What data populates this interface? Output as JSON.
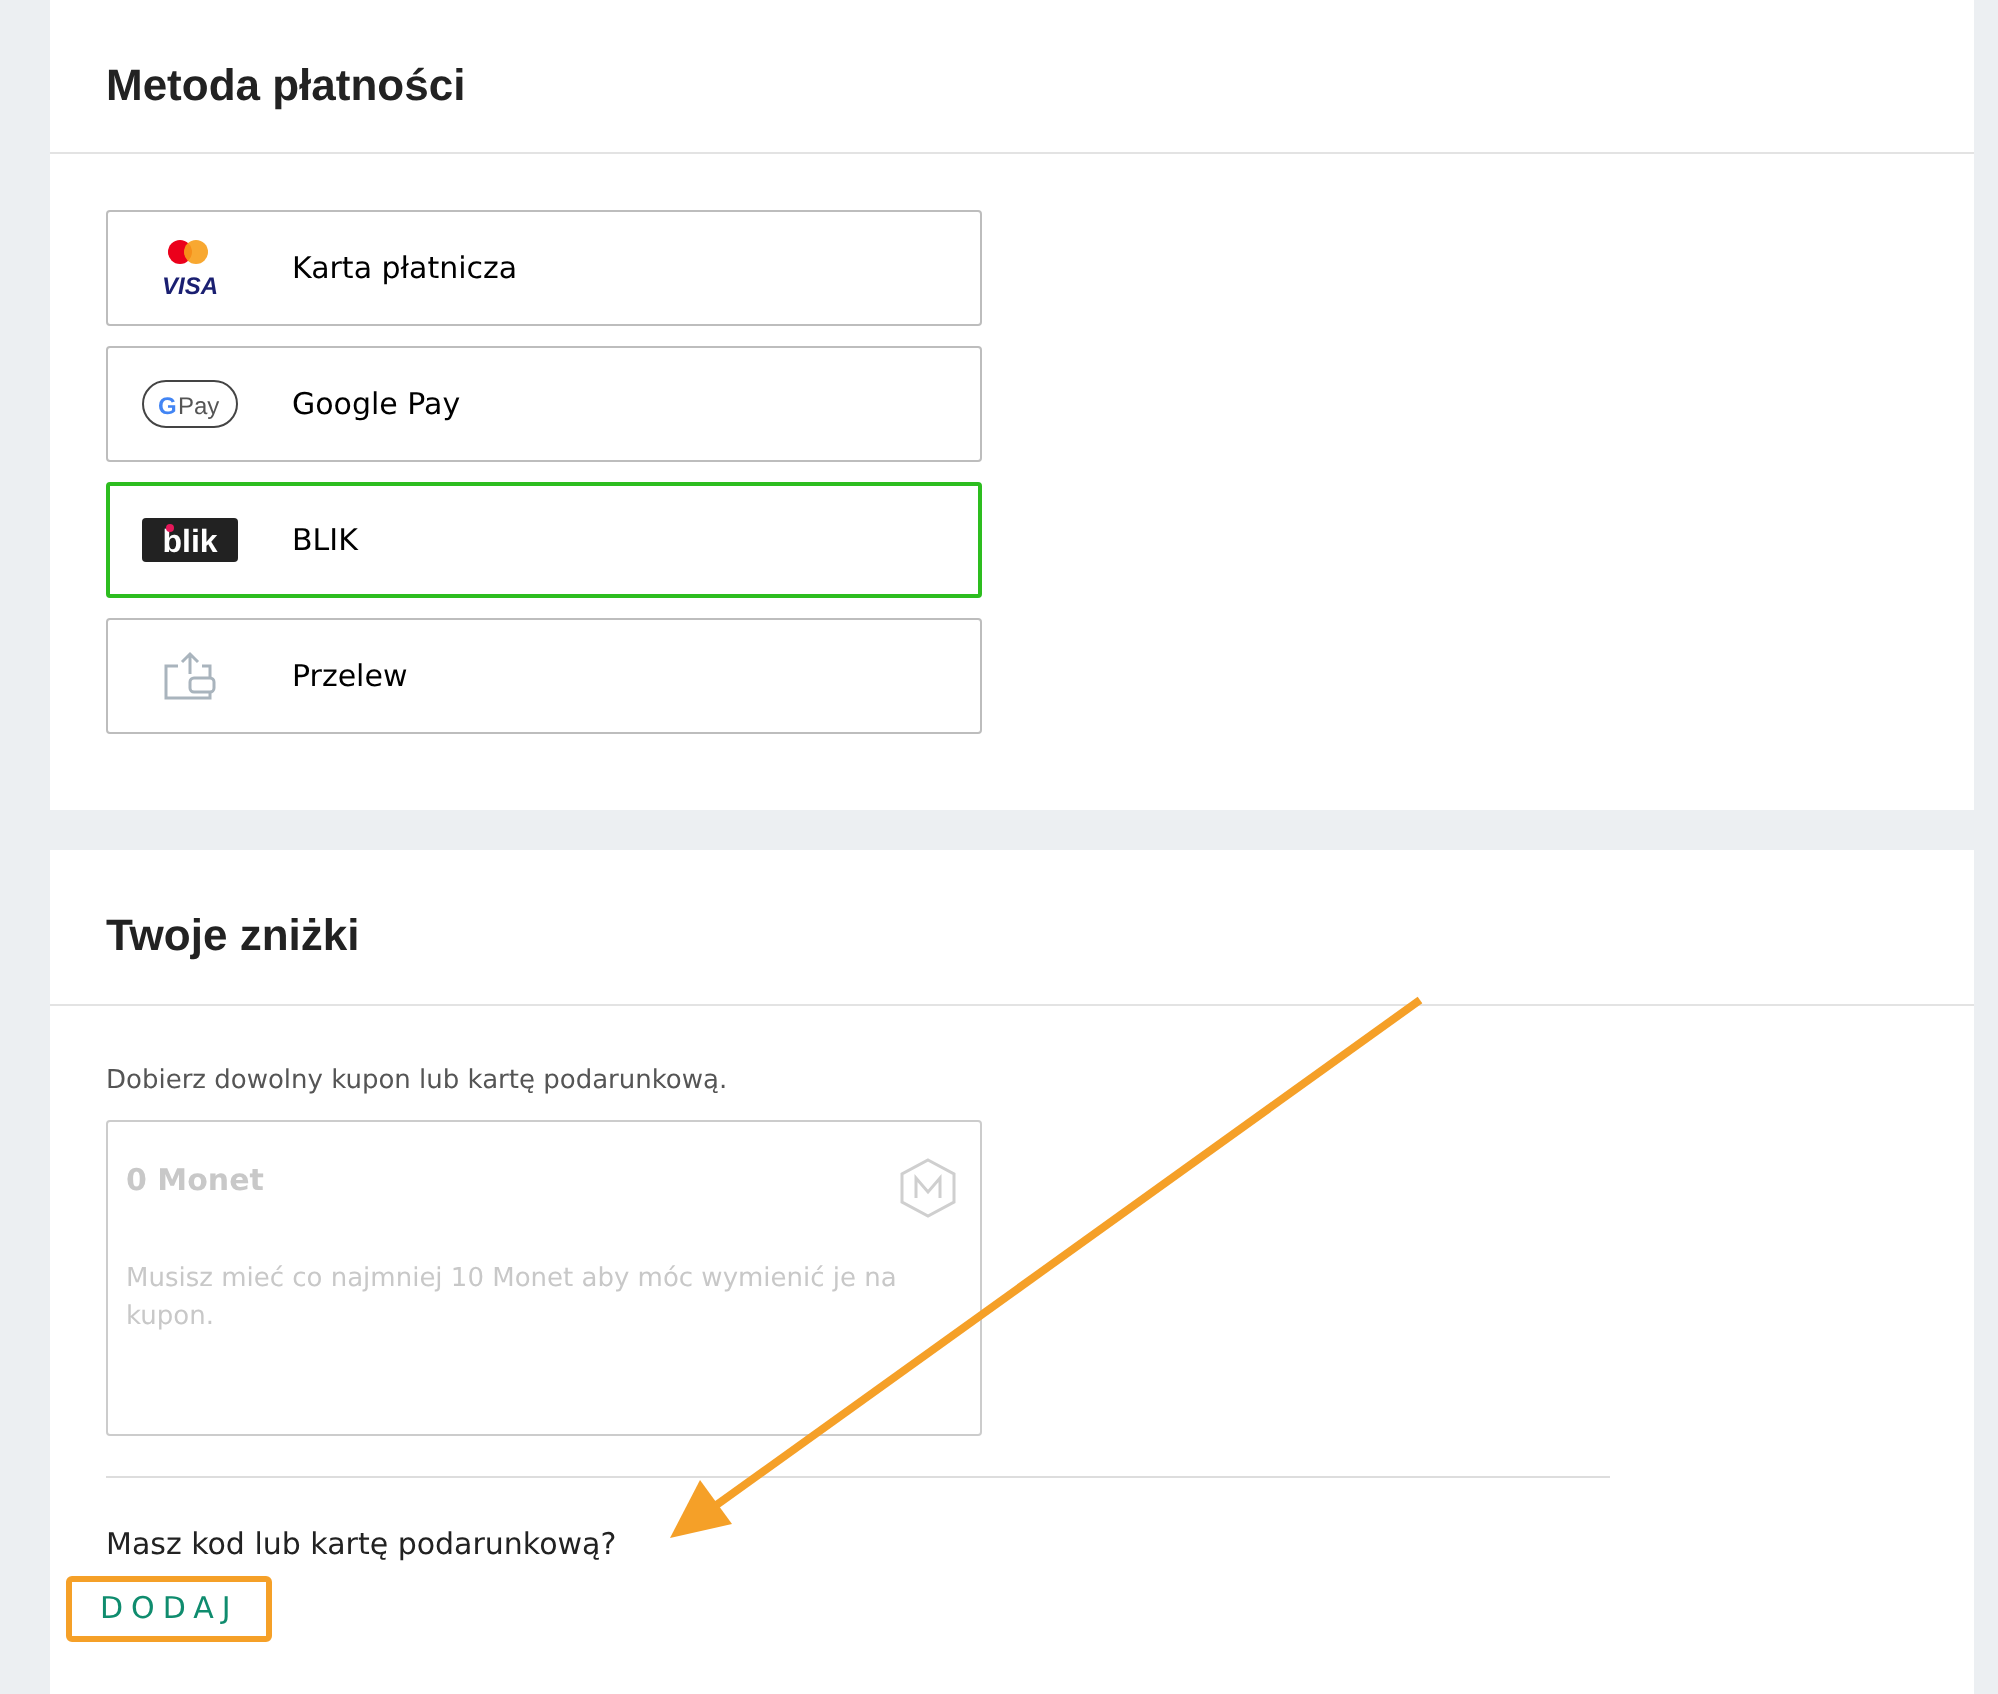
{
  "payment": {
    "title": "Metoda płatności",
    "methods": [
      {
        "kind": "card",
        "label": "Karta płatnicza",
        "selected": false,
        "logo_text": [
          "VISA"
        ]
      },
      {
        "kind": "gpay",
        "label": "Google Pay",
        "selected": false,
        "logo_text": [
          "G",
          "Pay"
        ]
      },
      {
        "kind": "blik",
        "label": "BLIK",
        "selected": true,
        "logo_text": [
          "blik"
        ]
      },
      {
        "kind": "transfer",
        "label": "Przelew",
        "selected": false
      }
    ]
  },
  "discounts": {
    "title": "Twoje zniżki",
    "intro": "Dobierz dowolny kupon lub kartę podarunkową.",
    "coins": {
      "amount": "0 Monet",
      "note": "Musisz mieć co najmniej 10 Monet aby móc wymienić je na kupon.",
      "disabled": true
    },
    "question": "Masz kod lub kartę podarunkową?",
    "add_button": {
      "label": "DODAJ",
      "highlighted": true
    }
  },
  "annotation": {
    "kind": "arrow"
  }
}
